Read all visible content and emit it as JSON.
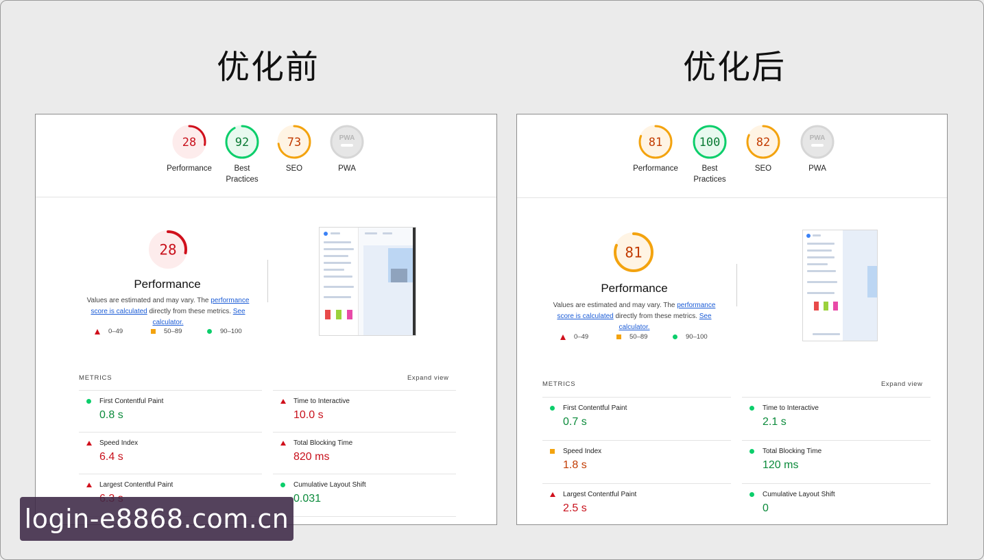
{
  "headings": {
    "before": "优化前",
    "after": "优化后"
  },
  "colors": {
    "fail": "#d0101c",
    "average": "#f3a30f",
    "pass": "#0cce6b",
    "link": "#1a5bd6"
  },
  "before": {
    "gauges": [
      {
        "score": "28",
        "value": 28,
        "label": "Performance",
        "status": "fail"
      },
      {
        "score": "92",
        "value": 92,
        "label": "Best Practices",
        "status": "pass"
      },
      {
        "score": "73",
        "value": 73,
        "label": "SEO",
        "status": "average"
      },
      {
        "score": "PWA",
        "value": 0,
        "label": "PWA",
        "status": "na"
      }
    ],
    "performance": {
      "score": "28",
      "value": 28,
      "status": "fail",
      "title": "Performance",
      "desc_pre": "Values are estimated and may vary. The ",
      "desc_link": "performance score is calculated",
      "desc_mid": " directly from these metrics. ",
      "desc_link2": "See calculator."
    },
    "legend": [
      "0–49",
      "50–89",
      "90–100"
    ],
    "metrics_title": "METRICS",
    "expand": "Expand view",
    "metrics": [
      {
        "name": "First Contentful Paint",
        "value": "0.8 s",
        "status": "pass"
      },
      {
        "name": "Time to Interactive",
        "value": "10.0 s",
        "status": "fail"
      },
      {
        "name": "Speed Index",
        "value": "6.4 s",
        "status": "fail"
      },
      {
        "name": "Total Blocking Time",
        "value": "820 ms",
        "status": "fail"
      },
      {
        "name": "Largest Contentful Paint",
        "value": "6.3 s",
        "status": "fail"
      },
      {
        "name": "Cumulative Layout Shift",
        "value": "0.031",
        "status": "pass"
      }
    ]
  },
  "after": {
    "gauges": [
      {
        "score": "81",
        "value": 81,
        "label": "Performance",
        "status": "average"
      },
      {
        "score": "100",
        "value": 100,
        "label": "Best Practices",
        "status": "pass"
      },
      {
        "score": "82",
        "value": 82,
        "label": "SEO",
        "status": "average"
      },
      {
        "score": "PWA",
        "value": 0,
        "label": "PWA",
        "status": "na"
      }
    ],
    "performance": {
      "score": "81",
      "value": 81,
      "status": "average",
      "title": "Performance",
      "desc_pre": "Values are estimated and may vary. The ",
      "desc_link": "performance score is calculated",
      "desc_mid": " directly from these metrics. ",
      "desc_link2": "See calculator."
    },
    "legend": [
      "0–49",
      "50–89",
      "90–100"
    ],
    "metrics_title": "METRICS",
    "expand": "Expand view",
    "metrics": [
      {
        "name": "First Contentful Paint",
        "value": "0.7 s",
        "status": "pass"
      },
      {
        "name": "Time to Interactive",
        "value": "2.1 s",
        "status": "pass"
      },
      {
        "name": "Speed Index",
        "value": "1.8 s",
        "status": "average"
      },
      {
        "name": "Total Blocking Time",
        "value": "120 ms",
        "status": "pass"
      },
      {
        "name": "Largest Contentful Paint",
        "value": "2.5 s",
        "status": "fail"
      },
      {
        "name": "Cumulative Layout Shift",
        "value": "0",
        "status": "pass"
      }
    ]
  },
  "watermark": "login-e8868.com.cn"
}
